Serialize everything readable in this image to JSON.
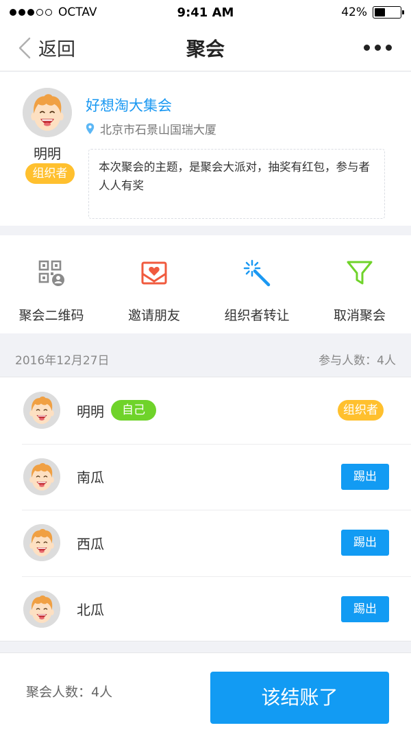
{
  "status_bar": {
    "carrier": "OCTAV",
    "time": "9:41 AM",
    "battery_percent": "42%",
    "battery_level": 0.42,
    "signal_strength": 3
  },
  "nav": {
    "back_label": "返回",
    "title": "聚会",
    "more_icon": "more-icon"
  },
  "event": {
    "organizer_name": "明明",
    "organizer_badge": "组织者",
    "title": "好想淘大集会",
    "location": "北京市石景山国瑞大厦",
    "description": "本次聚会的主题，是聚会大派对，抽奖有红包，参与者人人有奖"
  },
  "actions": [
    {
      "label": "聚会二维码",
      "icon": "qr-code-icon",
      "color": "#888888"
    },
    {
      "label": "邀请朋友",
      "icon": "invite-envelope-icon",
      "color": "#f05a3e"
    },
    {
      "label": "组织者转让",
      "icon": "magic-wand-icon",
      "color": "#1a98f2"
    },
    {
      "label": "取消聚会",
      "icon": "filter-icon",
      "color": "#6fd32a"
    }
  ],
  "summary": {
    "date": "2016年12月27日",
    "participant_count": "参与人数：4人"
  },
  "participants": [
    {
      "name": "明明",
      "self_badge": "自己",
      "org_badge": "组织者"
    },
    {
      "name": "南瓜",
      "kick_label": "踢出"
    },
    {
      "name": "西瓜",
      "kick_label": "踢出"
    },
    {
      "name": "北瓜",
      "kick_label": "踢出"
    }
  ],
  "bottom": {
    "count_label": "聚会人数：4人",
    "checkout_label": "该结账了"
  },
  "colors": {
    "accent_blue": "#129bf3",
    "badge_yellow": "#ffc02e",
    "badge_green": "#6fd32a",
    "invite_red": "#f05a3e"
  }
}
